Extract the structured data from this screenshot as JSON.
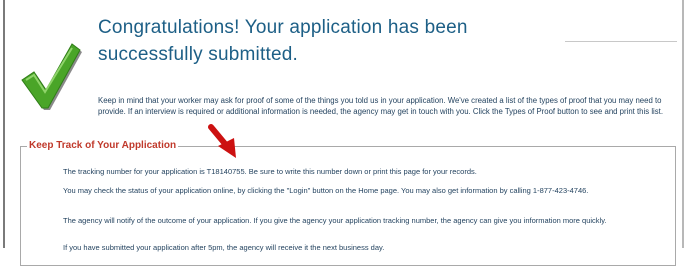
{
  "confirmation": {
    "title": "Congratulations! Your application has been successfully submitted.",
    "intro": "Keep in mind that your worker may ask for proof of some of the things you told us in your application. We've created a list of the types of proof that you may need to provide. If an interview is required or additional information is needed, the agency may get in touch with you. Click the Types of Proof button to see and print this list."
  },
  "track": {
    "legend": "Keep Track of Your Application",
    "p1": "The tracking number for your application is T18140755. Be sure to write this number down or print this page for your records.",
    "p2": "You may check the status of your application online, by clicking the \"Login\" button on the Home page. You may also get information by calling 1-877-423-4746.",
    "p3": "The agency will notify of the outcome of your application. If you give the agency your application tracking number, the agency can give you information more quickly.",
    "p4": "If you have submitted your application after 5pm, the agency will receive it the next business day."
  },
  "icons": {
    "checkmark": "green-check-icon",
    "arrow": "red-arrow-icon"
  },
  "colors": {
    "title": "#1d5f86",
    "legend": "#c0392b",
    "check": "#4aa528",
    "arrow": "#cc1111"
  }
}
